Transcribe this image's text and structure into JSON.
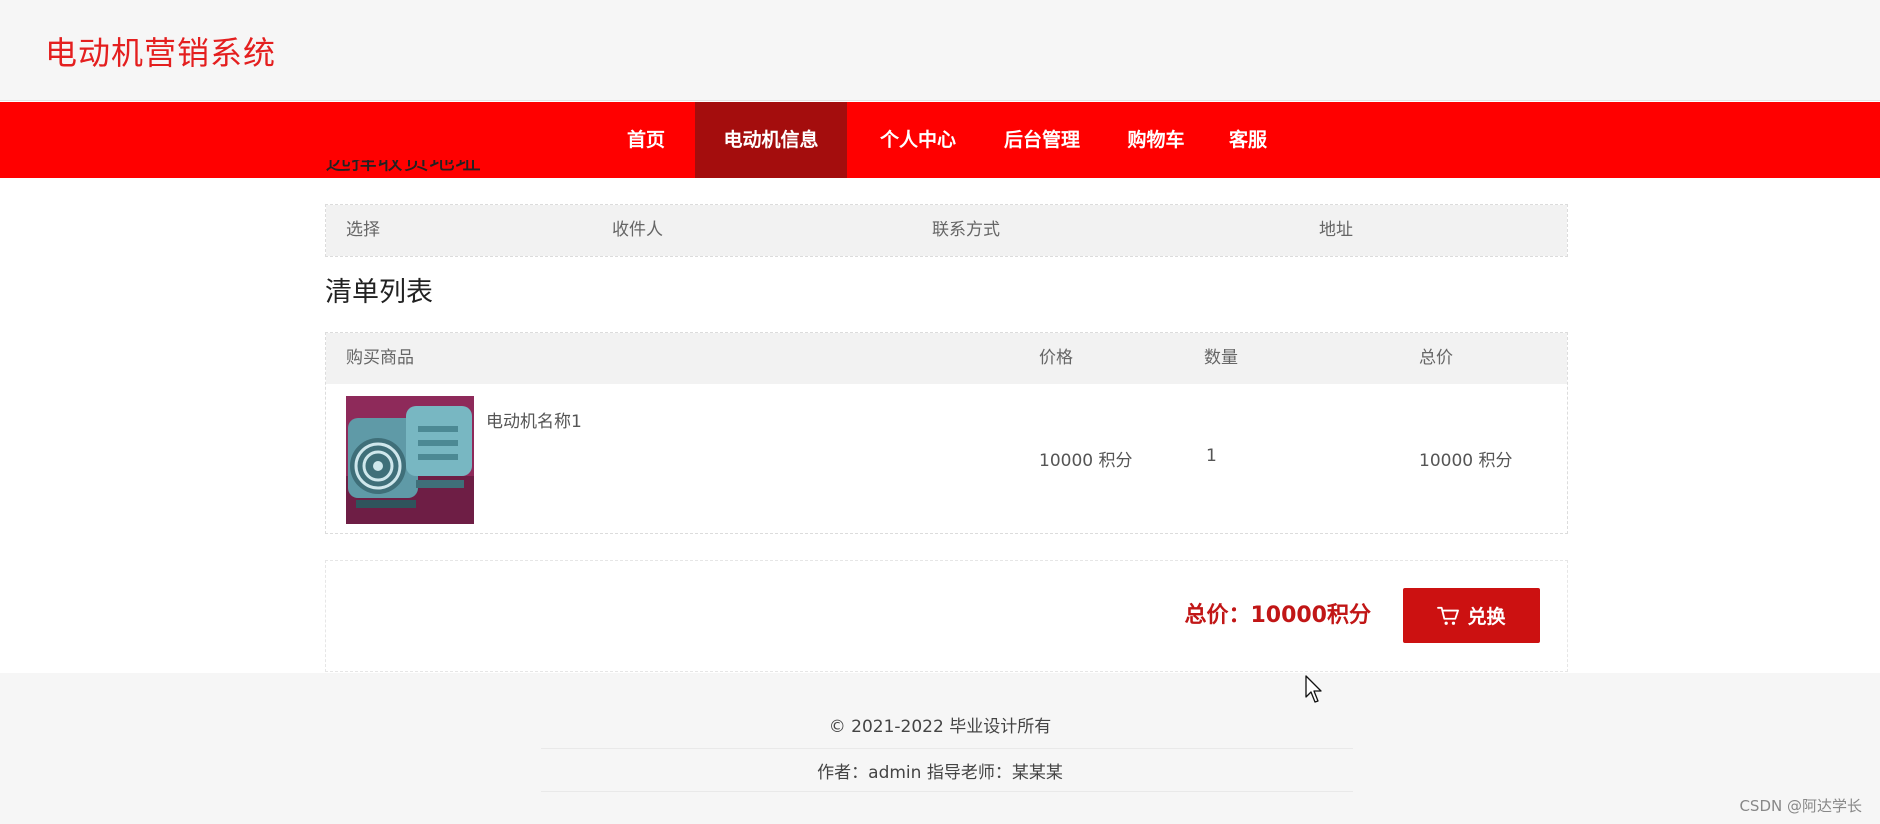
{
  "site": {
    "title": "电动机营销系统"
  },
  "nav": {
    "items": [
      {
        "label": "首页"
      },
      {
        "label": "电动机信息"
      },
      {
        "label": "个人中心"
      },
      {
        "label": "后台管理"
      },
      {
        "label": "购物车"
      },
      {
        "label": "客服"
      }
    ],
    "active_index": 1
  },
  "address_section": {
    "title": "选择收货地址",
    "columns": [
      "选择",
      "收件人",
      "联系方式",
      "地址"
    ]
  },
  "order_section": {
    "title": "清单列表",
    "columns": [
      "购买商品",
      "价格",
      "数量",
      "总价"
    ],
    "rows": [
      {
        "product_image_icon": "electric-motor-photo",
        "name": "电动机名称1",
        "price": "10000 积分",
        "quantity": "1",
        "subtotal": "10000 积分"
      }
    ]
  },
  "summary": {
    "total_label": "总价：10000积分",
    "exchange_button": "兑换",
    "cart_icon": "cart-icon"
  },
  "footer": {
    "copyright": "© 2021-2022 毕业设计所有",
    "credits": "作者：admin 指导老师：某某某"
  },
  "watermark": "CSDN @阿达学长",
  "colors": {
    "brand_red": "#ff0000",
    "active_nav": "#a40d0d",
    "button_red": "#cc1111",
    "title_red": "#e41f1f"
  }
}
